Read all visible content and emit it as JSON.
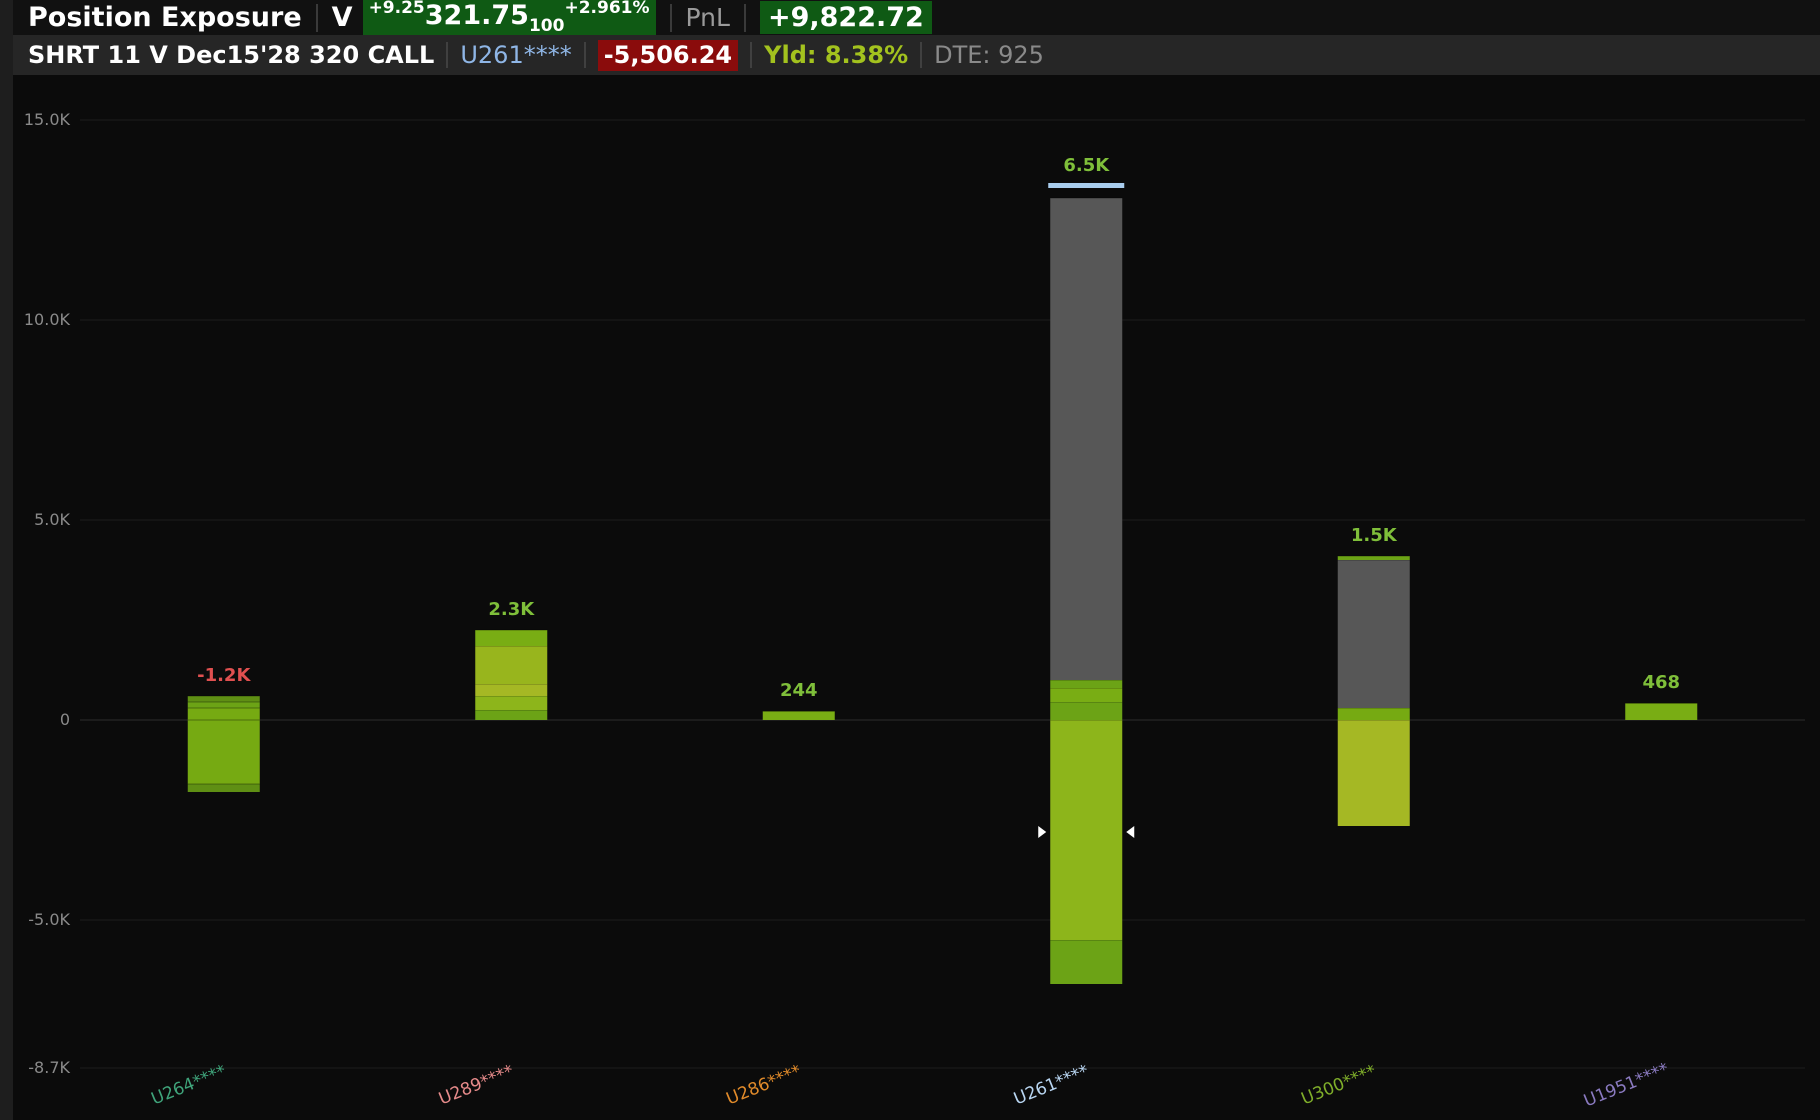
{
  "header": {
    "title": "Position Exposure",
    "symbol": "V",
    "change": "+9.25",
    "price_main": "321.75",
    "price_sub": "100",
    "change_pct": "+2.961%",
    "pnl_label": "PnL",
    "pnl_value": "+9,822.72"
  },
  "subheader": {
    "contract": "SHRT 11 V Dec15'28 320 CALL",
    "account": "U261****",
    "value": "-5,506.24",
    "yield": "Yld: 8.38%",
    "dte": "DTE: 925"
  },
  "colors": {
    "positive_label": "#7fbf3a",
    "negative_label": "#e05050",
    "gray_segment": "#575757",
    "marker": "#a9cdee"
  },
  "chart_data": {
    "type": "bar",
    "stacked": true,
    "ylim": [
      -8.7,
      15.0
    ],
    "y_unit": "K",
    "yticks": [
      {
        "v": 15.0,
        "label": "15.0K"
      },
      {
        "v": 10.0,
        "label": "10.0K"
      },
      {
        "v": 5.0,
        "label": "5.0K"
      },
      {
        "v": 0,
        "label": "0"
      },
      {
        "v": -5.0,
        "label": "-5.0K"
      },
      {
        "v": -8.7,
        "label": "-8.7K"
      }
    ],
    "grid": true,
    "categories": [
      {
        "label": "U264****",
        "label_color": "#3fa37a",
        "total_label": "-1.2K",
        "total_color": "#e05050",
        "segments": [
          {
            "from": 0.6,
            "to": 0.45,
            "color": "#5f8f14"
          },
          {
            "from": 0.45,
            "to": 0.3,
            "color": "#6ca316"
          },
          {
            "from": 0.3,
            "to": 0.0,
            "color": "#76aa12"
          },
          {
            "from": 0.0,
            "to": -1.6,
            "color": "#76aa12"
          },
          {
            "from": -1.6,
            "to": -1.8,
            "color": "#5f8f14"
          }
        ]
      },
      {
        "label": "U289****",
        "label_color": "#e58a8a",
        "total_label": "2.3K",
        "total_color": "#7fbf3a",
        "segments": [
          {
            "from": 0.0,
            "to": 0.25,
            "color": "#6ca316"
          },
          {
            "from": 0.25,
            "to": 0.6,
            "color": "#8db51b"
          },
          {
            "from": 0.6,
            "to": 0.9,
            "color": "#a5b824"
          },
          {
            "from": 0.9,
            "to": 1.85,
            "color": "#98b51d"
          },
          {
            "from": 1.85,
            "to": 2.25,
            "color": "#79ad14"
          }
        ]
      },
      {
        "label": "U286****",
        "label_color": "#e08a2a",
        "total_label": "244",
        "total_color": "#7fbf3a",
        "segments": [
          {
            "from": 0.0,
            "to": 0.22,
            "color": "#79ad14"
          }
        ]
      },
      {
        "label": "U261****",
        "label_color": "#b9d6f2",
        "total_label": "6.5K",
        "total_color": "#7fbf3a",
        "segments": [
          {
            "from": -6.6,
            "to": -5.5,
            "color": "#6ca316"
          },
          {
            "from": -5.5,
            "to": 0.0,
            "color": "#8db51b"
          },
          {
            "from": 0.0,
            "to": 0.45,
            "color": "#6ca316"
          },
          {
            "from": 0.45,
            "to": 0.8,
            "color": "#79ad14"
          },
          {
            "from": 0.8,
            "to": 1.0,
            "color": "#6ca316"
          },
          {
            "from": 1.0,
            "to": 13.05,
            "color": "#575757"
          }
        ],
        "marker_value": 13.35,
        "arrow_value": -2.8
      },
      {
        "label": "U300****",
        "label_color": "#7fae2a",
        "total_label": "1.5K",
        "total_color": "#7fbf3a",
        "segments": [
          {
            "from": -2.65,
            "to": 0.0,
            "color": "#a5b824"
          },
          {
            "from": 0.0,
            "to": 0.3,
            "color": "#76aa12"
          },
          {
            "from": 0.3,
            "to": 4.0,
            "color": "#575757"
          },
          {
            "from": 4.0,
            "to": 4.1,
            "color": "#6ca316"
          }
        ]
      },
      {
        "label": "U1951****",
        "label_color": "#8a7ac0",
        "total_label": "468",
        "total_color": "#7fbf3a",
        "segments": [
          {
            "from": 0.0,
            "to": 0.42,
            "color": "#79ad14"
          }
        ]
      }
    ]
  }
}
